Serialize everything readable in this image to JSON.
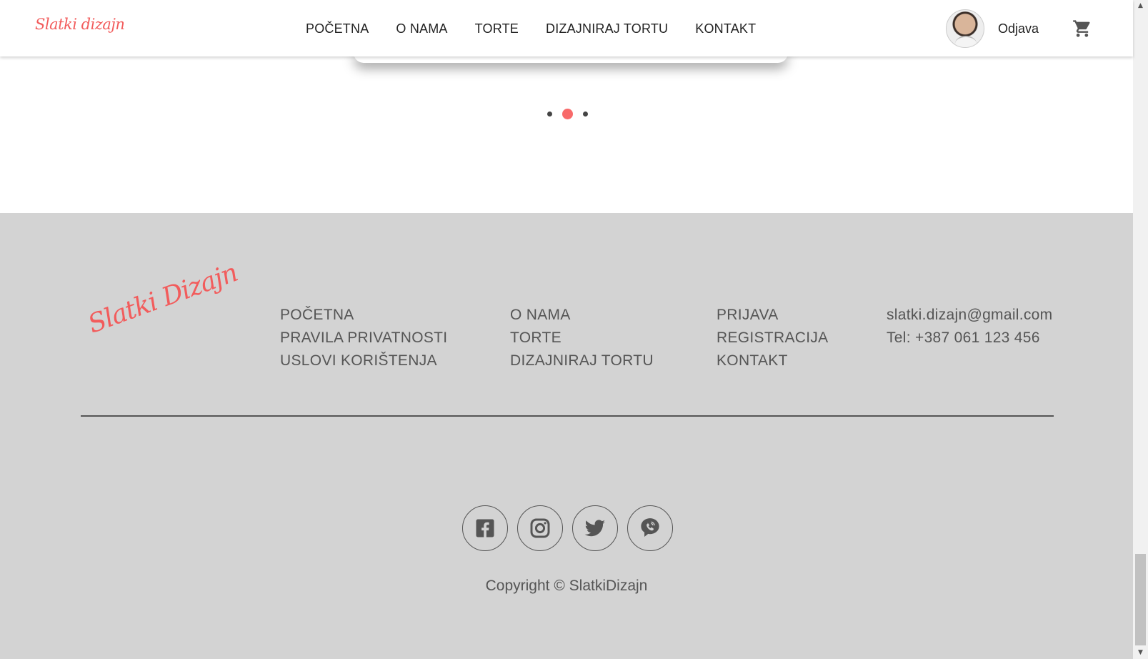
{
  "header": {
    "brand": "Slatki dizajn",
    "nav": [
      "POČETNA",
      "O NAMA",
      "TORTE",
      "DIZAJNIRAJ TORTU",
      "KONTAKT"
    ],
    "logout": "Odjava",
    "cart_icon": "cart-icon",
    "avatar": "user-avatar"
  },
  "carousel": {
    "slide_count": 3,
    "active_index": 1
  },
  "footer": {
    "logo": "Slatki Dizajn",
    "col1": [
      "POČETNA",
      "PRAVILA PRIVATNOSTI",
      "USLOVI KORIŠTENJA"
    ],
    "col2": [
      "O NAMA",
      "TORTE",
      "DIZAJNIRAJ TORTU"
    ],
    "col3": [
      "PRIJAVA",
      "REGISTRACIJA",
      "KONTAKT"
    ],
    "contact": [
      "slatki.dizajn@gmail.com",
      "Tel: +387 061 123 456"
    ],
    "socials": [
      "facebook-icon",
      "instagram-icon",
      "twitter-icon",
      "viber-icon"
    ],
    "copyright": "Copyright © SlatkiDizajn"
  },
  "colors": {
    "accent": "#f25c5c",
    "footer_bg": "#d3d3d3",
    "text": "#222222",
    "footer_text": "#555555"
  }
}
